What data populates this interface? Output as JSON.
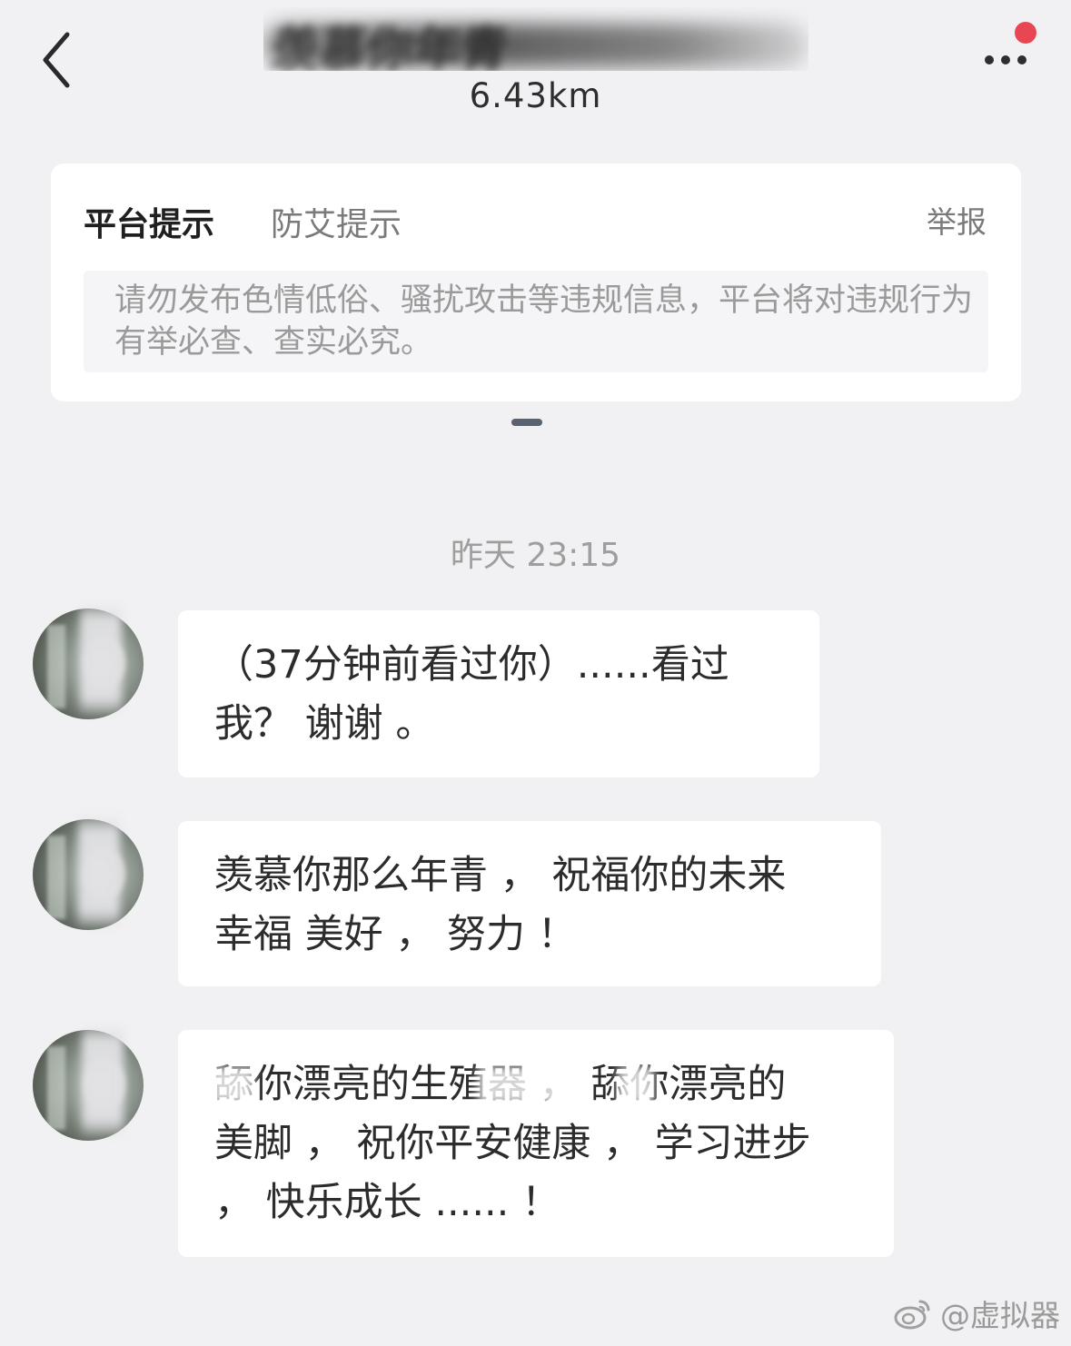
{
  "header": {
    "title": "羡慕你年青",
    "distance": "6.43km",
    "unread_dot_color": "#e94654"
  },
  "notice": {
    "tabs": [
      {
        "label": "平台提示"
      },
      {
        "label": "防艾提示"
      }
    ],
    "report_label": "举报",
    "body": "请勿发布色情低俗、骚扰攻击等违规信息，平台将对违规行为有举必查、查实必究。"
  },
  "chat": {
    "timestamp": "昨天 23:15",
    "messages": [
      {
        "text": "（37分钟前看过你）......看过\n我？ 谢谢 。"
      },
      {
        "text": "羡慕你那么年青 ， 祝福你的未来\n幸福 美好 ， 努力 ！"
      },
      {
        "text": "舔你漂亮的生殖器 ， 舔你漂亮的\n美脚 ， 祝你平安健康 ， 学习进步\n， 快乐成长 ...... ！"
      }
    ]
  },
  "watermark": {
    "icon": "weibo-icon",
    "text": "@虚拟器"
  },
  "icons": {
    "back": "chevron-left-icon",
    "more": "more-dots-icon"
  }
}
